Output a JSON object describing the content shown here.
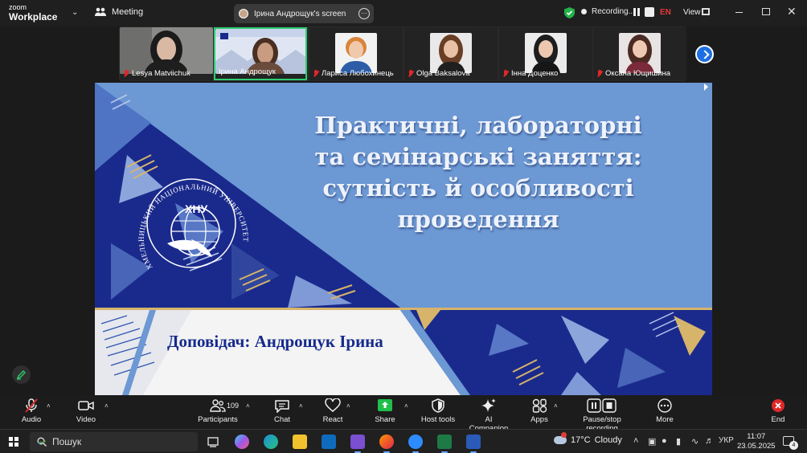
{
  "titlebar": {
    "brand_line1": "zoom",
    "brand_line2": "Workplace",
    "meeting_label": "Meeting",
    "screen_share_label": "Ірина  Андрощук's screen",
    "recording_label": "Recording...",
    "language": "EN",
    "view_label": "View"
  },
  "gallery": {
    "participants": [
      {
        "name": "Lesya Matviichuk",
        "muted": true,
        "active": false
      },
      {
        "name": "Ірина  Андрощук",
        "muted": false,
        "active": true
      },
      {
        "name": "Лариса Любохинець",
        "muted": true,
        "active": false
      },
      {
        "name": "Olga Baksalova",
        "muted": true,
        "active": false
      },
      {
        "name": "Інна Доценко",
        "muted": true,
        "active": false
      },
      {
        "name": "Оксана Ющишина",
        "muted": true,
        "active": false
      }
    ]
  },
  "slide": {
    "title_line1": "Практичні, лабораторні",
    "title_line2": "та семінарські заняття:",
    "title_line3": "сутність й особливості проведення",
    "speaker": "Доповідач: Андрощук Ірина",
    "logo_abbr": "ХНУ",
    "logo_ring_text": "ХМЕЛЬНИЦЬКИЙ НАЦІОНАЛЬНИЙ УНІВЕРСИТЕТ",
    "colors": {
      "sky": "#6c98d4",
      "navy": "#1a2a8c",
      "gold": "#d6b46a"
    }
  },
  "toolbar": {
    "audio": "Audio",
    "video": "Video",
    "participants": "Participants",
    "participants_count": "109",
    "chat": "Chat",
    "react": "React",
    "share": "Share",
    "host_tools": "Host tools",
    "ai_companion": "AI Companion",
    "apps": "Apps",
    "pause_stop_recording": "Pause/stop recording",
    "more": "More",
    "end": "End"
  },
  "taskbar": {
    "search_placeholder": "Пошук",
    "weather_temp": "17°C",
    "weather_desc": "Cloudy",
    "keyboard_lang": "УКР",
    "time": "11:07",
    "date": "23.05.2025",
    "notification_count": "4"
  }
}
